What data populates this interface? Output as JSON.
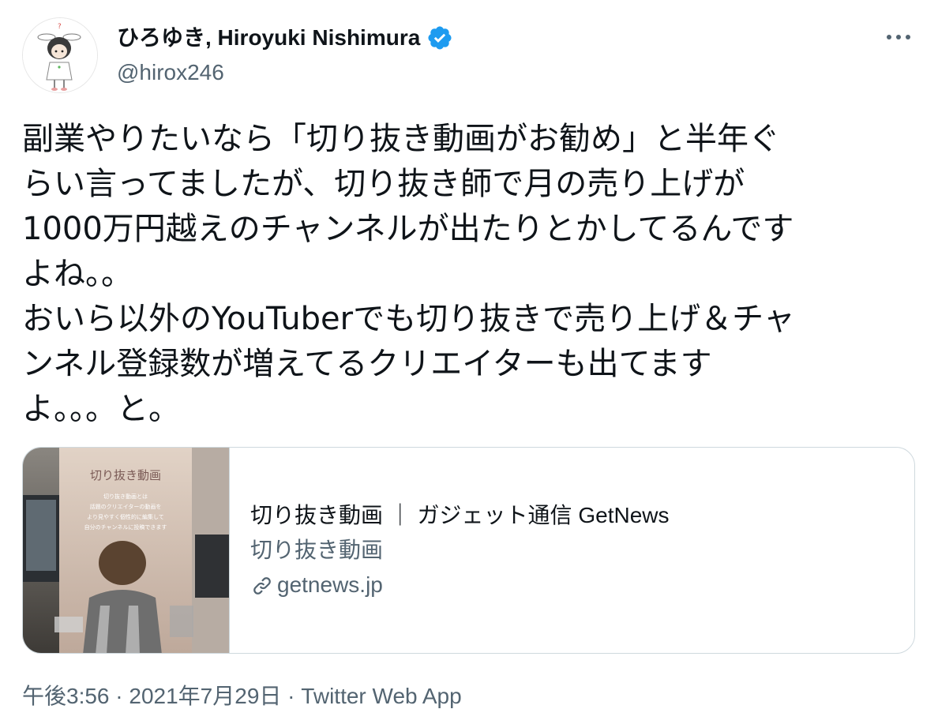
{
  "user": {
    "display_name": "ひろゆき, Hiroyuki Nishimura",
    "handle": "@hirox246"
  },
  "tweet": {
    "lines": [
      "副業やりたいなら「切り抜き動画がお勧め」と半年ぐ",
      "らい言ってましたが、切り抜き師で月の売り上げが",
      "1000万円越えのチャンネルが出たりとかしてるんです",
      "よね。。",
      "おいら以外のYouTuberでも切り抜きで売り上げ＆チャ",
      "ンネル登録数が増えてるクリエイターも出てます",
      "よ。。。と。"
    ]
  },
  "card": {
    "thumb_title": "切り抜き動画",
    "thumb_caption_lines": [
      "切り抜き動画とは",
      "話題のクリエイターの動画を",
      "より見やすく個性的に編集して",
      "自分のチャンネルに投稿できます"
    ],
    "title": "切り抜き動画 ｜ ガジェット通信 GetNews",
    "description": "切り抜き動画",
    "domain": "getnews.jp"
  },
  "meta": {
    "time": "午後3:56",
    "separator": " · ",
    "date": "2021年7月29日",
    "source": "Twitter Web App"
  },
  "colors": {
    "text": "#0f1419",
    "secondary": "#536471",
    "verified": "#1d9bf0",
    "border": "#cfd9de"
  },
  "icons": {
    "verified": "verified-badge-icon",
    "more": "more-horizontal-icon",
    "link": "link-icon"
  }
}
